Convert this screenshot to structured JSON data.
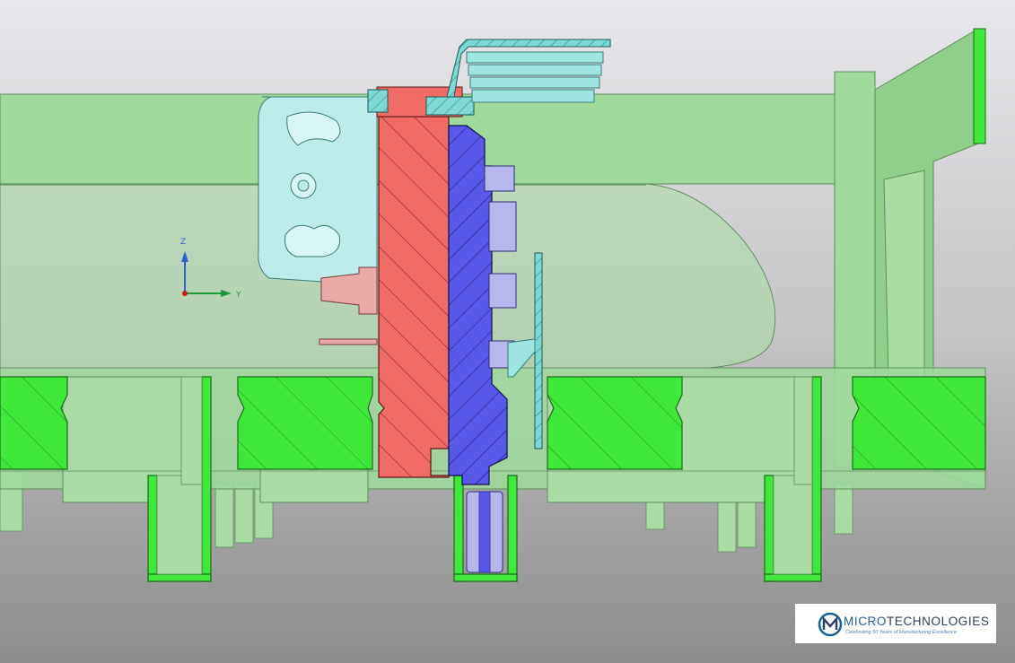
{
  "viewport": {
    "axes": {
      "z_label": "Z",
      "y_label": "Y"
    },
    "colors": {
      "background_top": "#e6e6ea",
      "background_bottom": "#8e8e8e",
      "frame_green": "#9fd99b",
      "section_green": "#3fe83a",
      "red_part": "#f06a66",
      "blue_part": "#5555e8",
      "cyan_part": "#9ee5e2",
      "pink_part": "#e9a9a6",
      "lavender_pin": "#b7b7ee"
    }
  },
  "logo": {
    "brand_prefix": "MICRO",
    "brand_suffix": "TECHNOLOGIES",
    "tagline": "Celebrating 50 Years of Manufacturing Excellence"
  }
}
